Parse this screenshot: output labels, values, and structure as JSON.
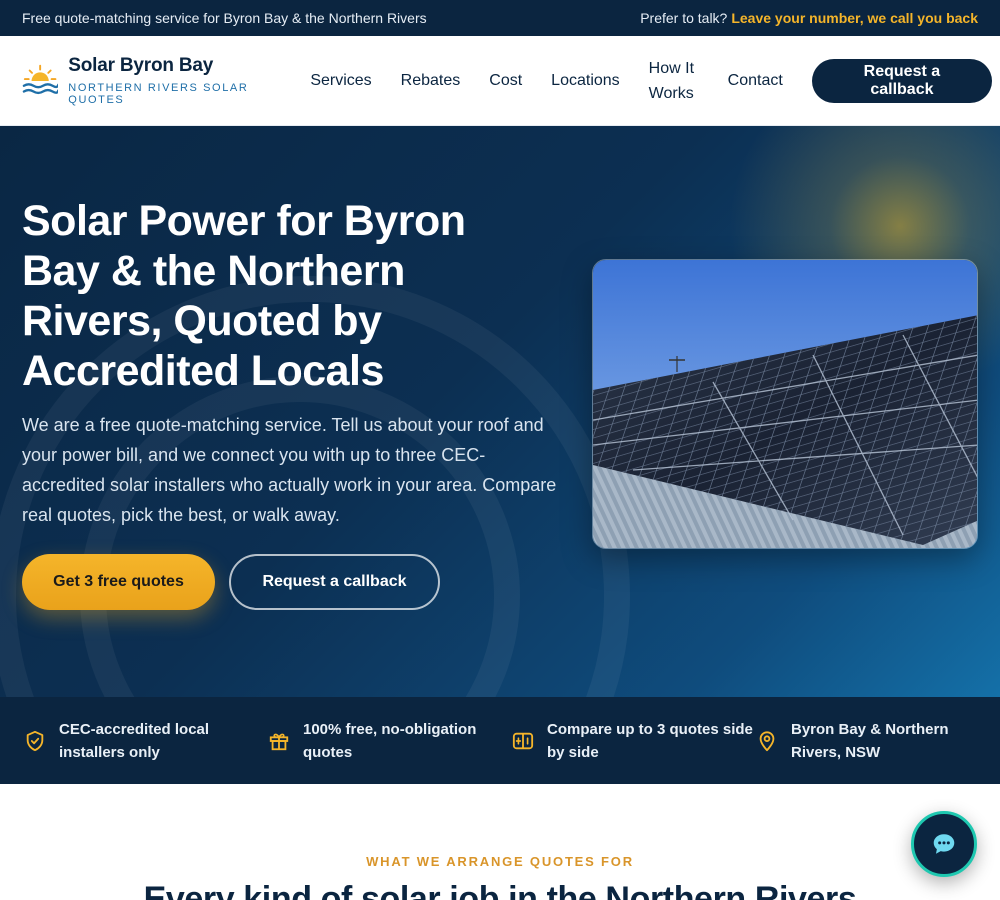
{
  "topbar": {
    "left_text": "Free quote-matching service for Byron Bay & the Northern Rivers",
    "prompt": "Prefer to talk?",
    "link": "Leave your number, we call you back"
  },
  "brand": {
    "name": "Solar Byron Bay",
    "tagline": "NORTHERN RIVERS SOLAR QUOTES",
    "logo_icon": "sun-over-waves-icon"
  },
  "nav": {
    "items": [
      "Services",
      "Rebates",
      "Cost",
      "Locations",
      "How It Works",
      "Contact"
    ],
    "cta": "Request a callback"
  },
  "hero": {
    "title": "Solar Power for Byron Bay & the Northern Rivers, Quoted by Accredited Locals",
    "body": "We are a free quote-matching service. Tell us about your roof and your power bill, and we connect you with up to three CEC-accredited solar installers who actually work in your area. Compare real quotes, pick the best, or walk away.",
    "primary_button": "Get 3 free quotes",
    "secondary_button": "Request a callback"
  },
  "trust": [
    {
      "icon": "shield-check-icon",
      "text": "CEC-accredited local installers only"
    },
    {
      "icon": "gift-icon",
      "text": "100% free, no-obligation quotes"
    },
    {
      "icon": "compare-icon",
      "text": "Compare up to 3 quotes side by side"
    },
    {
      "icon": "map-pin-icon",
      "text": "Byron Bay & Northern Rivers, NSW"
    }
  ],
  "section": {
    "eyebrow": "WHAT WE ARRANGE QUOTES FOR",
    "title": "Every kind of solar job in the Northern Rivers"
  },
  "colors": {
    "navy": "#0b2540",
    "accent": "#f5b52a",
    "link_blue": "#1f6fa8",
    "chat_ring": "#1ec8b0"
  },
  "chat": {
    "icon": "chat-bubble-icon"
  }
}
